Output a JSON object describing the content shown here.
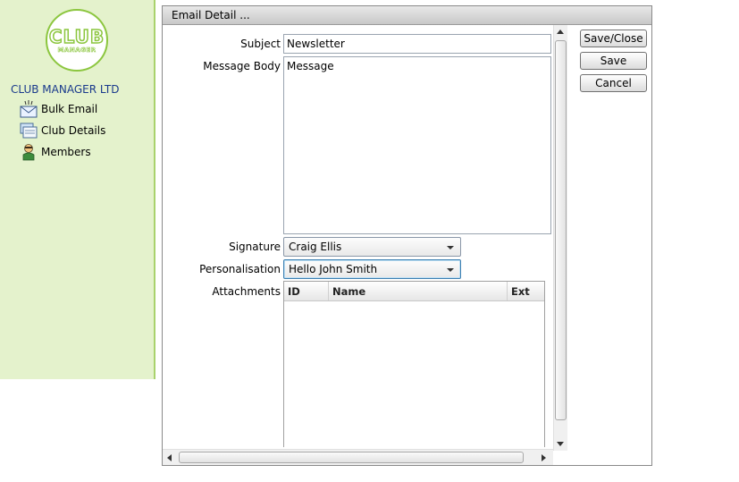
{
  "sidebar": {
    "logo": {
      "line1": "CLUB",
      "line2": "MANAGER"
    },
    "company": "CLUB MANAGER LTD",
    "items": [
      {
        "label": "Bulk Email",
        "icon": "envelope-icon"
      },
      {
        "label": "Club Details",
        "icon": "club-details-icon"
      },
      {
        "label": "Members",
        "icon": "member-icon"
      }
    ]
  },
  "dialog": {
    "title": "Email Detail ...",
    "fields": {
      "subject_label": "Subject",
      "subject_value": "Newsletter",
      "body_label": "Message Body",
      "body_value": "Message",
      "signature_label": "Signature",
      "signature_value": "Craig Ellis",
      "personalisation_label": "Personalisation",
      "personalisation_value": "Hello John Smith",
      "attachments_label": "Attachments"
    },
    "attachments": {
      "columns": [
        "ID",
        "Name",
        "Ext"
      ],
      "rows": []
    },
    "buttons": {
      "save_close": "Save/Close",
      "save": "Save",
      "cancel": "Cancel"
    }
  },
  "colors": {
    "sidebar_bg": "#e4f2cc",
    "sidebar_border": "#a9d26c",
    "company_text": "#1a3a8c",
    "logo_green": "#8cc63f"
  }
}
